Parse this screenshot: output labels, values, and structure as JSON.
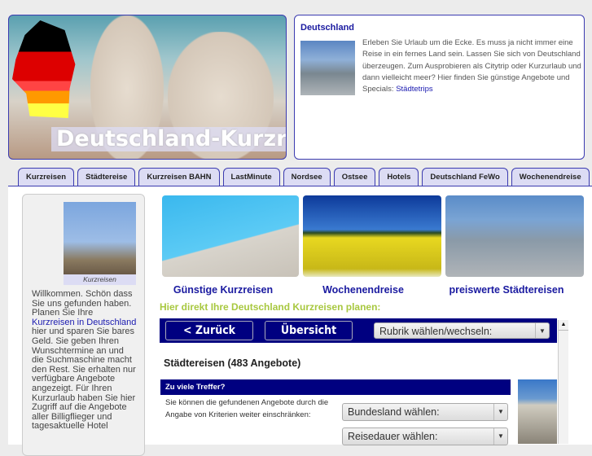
{
  "banner": {
    "title": "Deutschland-Kurzreisen"
  },
  "info": {
    "heading": "Deutschland",
    "text": "Erleben Sie Urlaub um die Ecke. Es muss ja nicht immer eine Reise in ein fernes Land sein. Lassen Sie sich von Deutschland überzeugen. Zum Ausprobieren als Citytrip oder Kurzurlaub und dann vielleicht meer? Hier finden Sie günstige Angebote und Specials:",
    "link": "Städtetrips"
  },
  "tabs": [
    "Kurzreisen",
    "Städtereise",
    "Kurzreisen BAHN",
    "LastMinute",
    "Nordsee",
    "Ostsee",
    "Hotels",
    "Deutschland FeWo",
    "Wochenendreise"
  ],
  "sidebar": {
    "caption": "Kurzreisen",
    "text1": "Willkommen. Schön dass Sie uns gefunden haben. Planen Sie Ihre",
    "link": "Kurzreisen in Deutschland",
    "text2": "hier und sparen Sie bares Geld. Sie geben Ihren Wunschtermine an und die Suchmaschine macht den Rest. Sie erhalten nur verfügbare Angebote angezeigt. Für Ihren Kurzurlaub haben Sie hier Zugriff auf die Angebote aller Billigflieger und tagesaktuelle Hotel"
  },
  "teasers": [
    "Günstige Kurzreisen",
    "Wochenendreise",
    "preiswerte Städtereisen"
  ],
  "planner": {
    "heading": "Hier direkt Ihre Deutschland Kurzreisen planen:",
    "back": "< Zurück",
    "overview": "Übersicht",
    "rubrik": "Rubrik wählen/wechseln:",
    "results": "Städtereisen (483 Angebote)",
    "bar": "Zu viele Treffer?",
    "hint": "Sie können die gefundenen Angebote durch die Angabe von Kriterien weiter einschränken:",
    "bundesland": "Bundesland wählen:",
    "dauer": "Reisedauer wählen:"
  }
}
